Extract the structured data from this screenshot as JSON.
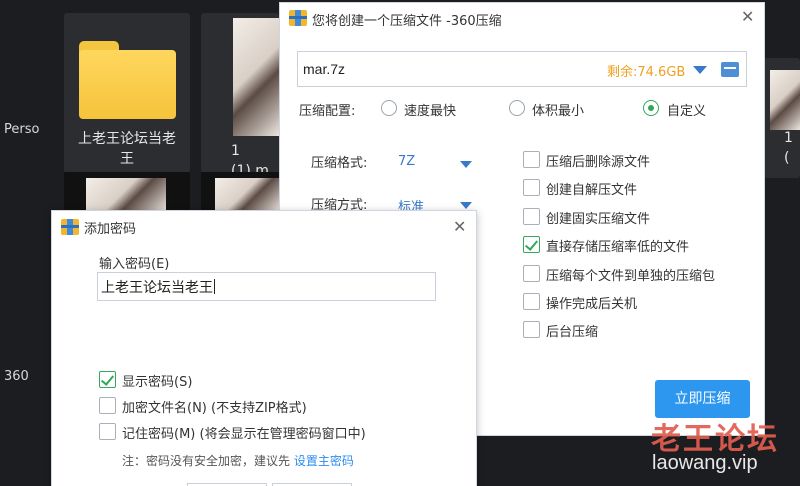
{
  "background": {
    "sidebar_labels": [
      "Perso",
      "360"
    ],
    "tiles": [
      {
        "name": "上老王论坛当老王",
        "type": "folder"
      },
      {
        "name": "1 (1).m",
        "type": "image"
      },
      {
        "name": "1 (",
        "type": "image"
      }
    ]
  },
  "compress_dialog": {
    "title": "您将创建一个压缩文件 -360压缩",
    "path": "mar.7z",
    "free_space": "剩余:74.6GB",
    "config_label": "压缩配置:",
    "config_options": [
      "速度最快",
      "体积最小",
      "自定义"
    ],
    "config_selected": "自定义",
    "format_label": "压缩格式:",
    "format_value": "7Z",
    "method_label": "压缩方式:",
    "method_value": "标准",
    "options": [
      {
        "label": "压缩后删除源文件",
        "checked": false
      },
      {
        "label": "创建自解压文件",
        "checked": false
      },
      {
        "label": "创建固实压缩文件",
        "checked": false
      },
      {
        "label": "直接存储压缩率低的文件",
        "checked": true
      },
      {
        "label": "压缩每个文件到单独的压缩包",
        "checked": false
      },
      {
        "label": "操作完成后关机",
        "checked": false
      },
      {
        "label": "后台压缩",
        "checked": false
      }
    ],
    "submit_label": "立即压缩"
  },
  "password_dialog": {
    "title": "添加密码",
    "input_label": "输入密码(E)",
    "password_value": "上老王论坛当老王",
    "show_password": {
      "label": "显示密码(S)",
      "checked": true
    },
    "encrypt_names": {
      "label": "加密文件名(N) (不支持ZIP格式)",
      "checked": false
    },
    "remember": {
      "label": "记住密码(M) (将会显示在管理密码窗口中)",
      "checked": false
    },
    "note": "注：密码没有安全加密，建议先 ",
    "note_link": "设置主密码"
  },
  "watermark": {
    "cn": "老王论坛",
    "en": "laowang.vip"
  },
  "colors": {
    "accent": "#2d96ef",
    "radio_on": "#2fa85a",
    "free_space": "#f0a020",
    "watermark": "#e25d50"
  }
}
